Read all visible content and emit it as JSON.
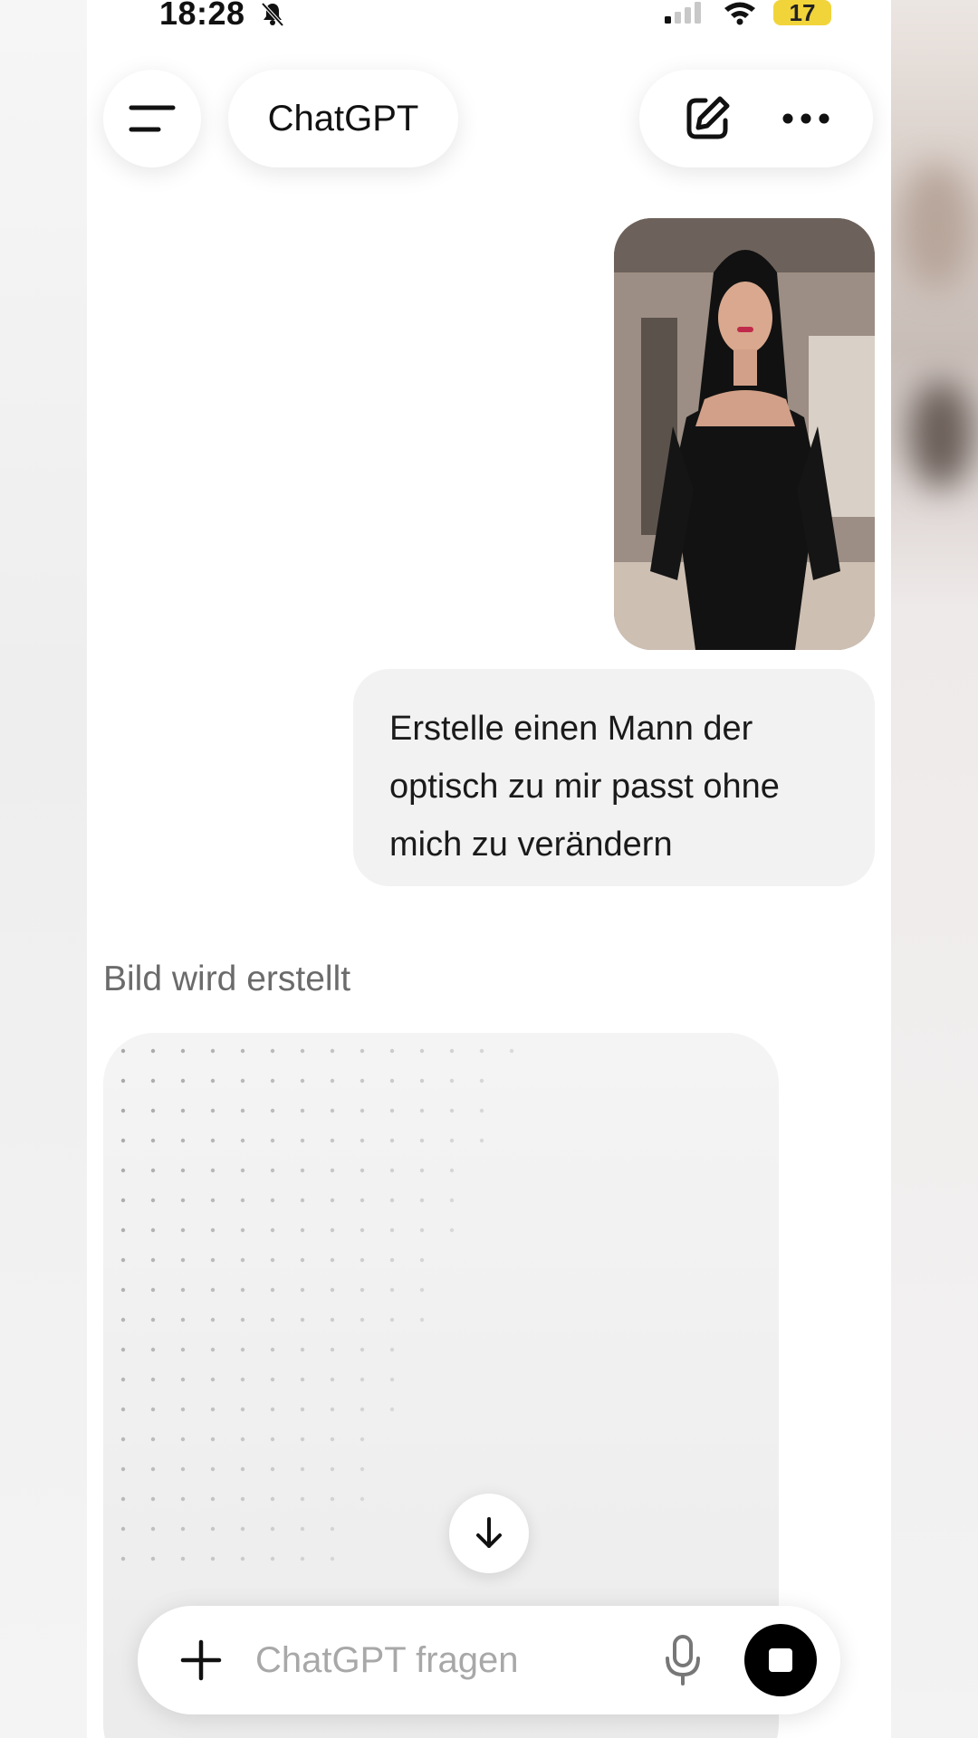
{
  "status_bar": {
    "time": "18:28",
    "battery": "17",
    "icons": [
      "bell-muted-icon",
      "signal-icon",
      "wifi-icon",
      "battery-icon"
    ]
  },
  "header": {
    "title": "ChatGPT",
    "icons": [
      "menu-icon",
      "new-chat-icon",
      "more-icon"
    ]
  },
  "conversation": {
    "user_image": {
      "description_icon": "photo-attachment"
    },
    "user_message": "Erstelle einen Mann der optisch zu mir passt ohne mich zu verändern",
    "assistant_status": "Bild wird erstellt"
  },
  "composer": {
    "placeholder": "ChatGPT fragen",
    "value": "",
    "icons": [
      "plus-icon",
      "mic-icon",
      "stop-icon"
    ]
  },
  "colors": {
    "background": "#ffffff",
    "bubble": "#f2f2f2",
    "battery": "#f1d43a",
    "muted_text": "#6b6b6b",
    "placeholder": "#a8a8a8"
  }
}
